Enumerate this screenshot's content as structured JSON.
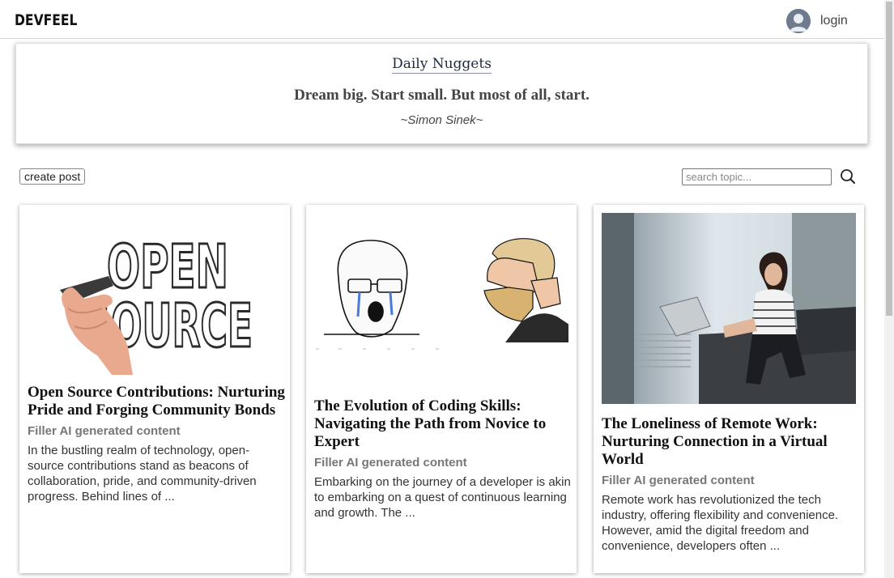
{
  "nav": {
    "brand": "DEVFEEL",
    "login_label": "login"
  },
  "daily": {
    "title": "Daily Nuggets",
    "quote": "Dream big. Start small. But most of all, start.",
    "author": "~Simon Sinek~"
  },
  "toolbar": {
    "create_label": "create post",
    "search_placeholder": "search topic..."
  },
  "posts": [
    {
      "title": "Open Source Contributions: Nurturing Pride and Forging Community Bonds",
      "subtitle": "Filler AI generated content",
      "excerpt": "In the bustling realm of technology, open-source contributions stand as beacons of collaboration, pride, and community-driven progress. Behind lines of ...",
      "image_text_line1": "OPEN",
      "image_text_line2": "SOURCE"
    },
    {
      "title": "The Evolution of Coding Skills: Navigating the Path from Novice to Expert",
      "subtitle": "Filler AI generated content",
      "excerpt": "Embarking on the journey of a developer is akin to embarking on a quest of continuous learning and growth. The ..."
    },
    {
      "title": "The Loneliness of Remote Work: Nurturing Connection in a Virtual World",
      "subtitle": "Filler AI generated content",
      "excerpt": "Remote work has revolutionized the tech industry, offering flexibility and convenience. However, amid the digital freedom and convenience, developers often ..."
    }
  ],
  "colors": {
    "nuggets_title": "#1e2a44",
    "subtitle_gray": "#777777",
    "avatar": "#6e7a8e"
  }
}
